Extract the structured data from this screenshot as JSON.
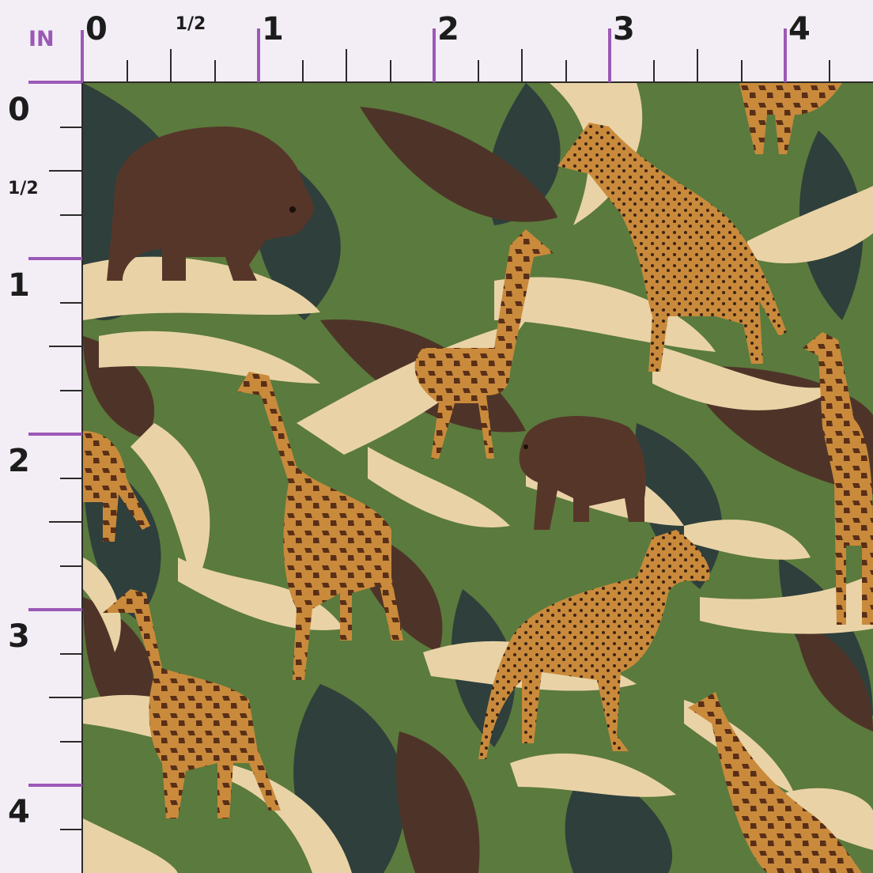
{
  "ruler": {
    "unit": "IN",
    "top_labels": {
      "zero": "0",
      "half": "1/2",
      "one": "1",
      "two": "2",
      "three": "3",
      "four": "4"
    },
    "left_labels": {
      "zero": "0",
      "half": "1/2",
      "one": "1",
      "two": "2",
      "three": "3",
      "four": "4"
    },
    "accent_color": "#9b59b6",
    "tick_color": "#2a2a2a"
  },
  "pattern": {
    "colors": {
      "cream": "#e9d3a6",
      "forest_green": "#5b7a3d",
      "dark_slate": "#2f3f3c",
      "brown": "#4e3428",
      "giraffe_tan": "#c98a3c",
      "giraffe_spot": "#5a2f18",
      "bear_brown": "#57362a"
    },
    "animals": [
      "bear-icon",
      "giraffe-icon",
      "leopard-icon"
    ]
  }
}
